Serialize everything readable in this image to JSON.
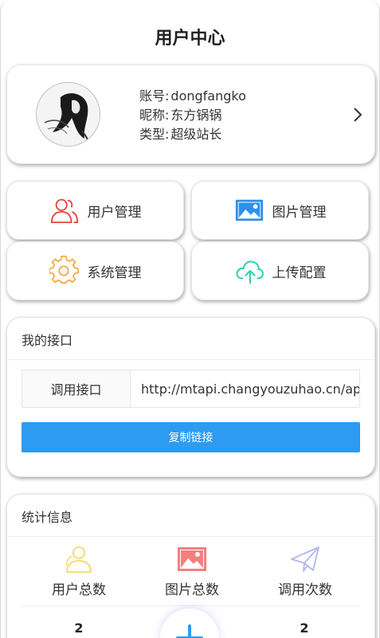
{
  "header": {
    "title": "用户中心"
  },
  "profile": {
    "account_label": "账号:",
    "account": "dongfangko",
    "nickname_label": "昵称:",
    "nickname": "东方锅锅",
    "type_label": "类型:",
    "type": "超级站长"
  },
  "menu": {
    "users": "用户管理",
    "images": "图片管理",
    "system": "系统管理",
    "upload": "上传配置"
  },
  "api_section": {
    "title": "我的接口",
    "label": "调用接口",
    "url": "http://mtapi.changyouzuhao.cn/api.php",
    "copy_button": "复制链接"
  },
  "stats_section": {
    "title": "统计信息",
    "items": [
      {
        "label": "用户总数",
        "value": "2"
      },
      {
        "label": "图片总数",
        "value": ""
      },
      {
        "label": "调用次数",
        "value": "2"
      }
    ]
  },
  "colors": {
    "accent_blue": "#2d9bf0",
    "user_icon_red": "#e8382f",
    "image_icon_blue": "#2e8ff0",
    "gear_orange": "#f3a43b",
    "cloud_teal": "#2ed3b4"
  }
}
